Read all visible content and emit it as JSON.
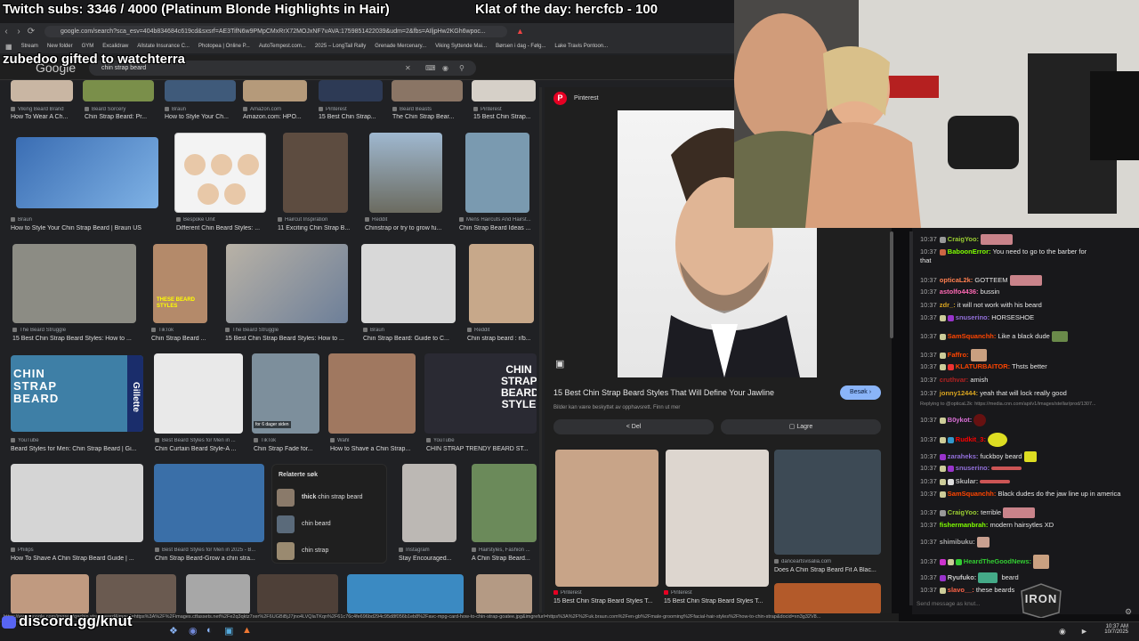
{
  "overlay": {
    "subs_goal": "Twitch subs: 3346 / 4000 (Platinum Blonde Highlights in Hair)",
    "klat": "Klat of the day: hercfcb - 100",
    "gift_alert": "zubedoo gifted to watchterra",
    "discord": "discord.gg/knut",
    "channel_logo": "IRON"
  },
  "browser": {
    "url": "google.com/search?sca_esv=404b834684c619cd&sxsrf=AE3TifN6w9PMpCMxRrX72MOJxNF7vAVA:1759851422039&udm=2&fbs=AIljpHw2KGh6wpoc...",
    "bookmarks": [
      "Stream",
      "New folder",
      "GYM",
      "Excalidraw",
      "Allstate Insurance C...",
      "Photopea | Online P...",
      "AutoTempest.com...",
      "2025 – LongTail Rally",
      "Grenade Mercenary...",
      "Viking Syttende Mai...",
      "Børsen i dag - Følg...",
      "Lake Travis Pontoon..."
    ],
    "search_query": "chin strap beard",
    "google_logo": "Google",
    "status_url": "https://www.google.com/imgres?q=chin strap beard&imgurl=https%3A%2F%2Fimages.ctfassets.net%2Fe2q3qktz7xer%2F6UGBiBjJ7jno4LVQlaTKqn%2F61c76c4fe696bd294c95d8f056b1eb8%2Favc-mpg-card-how-to-chin-strap-goatee.jpg&imgrefurl=https%3A%2F%2Fuk.braun.com%2Fen-gb%2Fmale-grooming%2Ffacial-hair-styles%2Fhow-to-chin-strap&docid=xn3g32V8..."
  },
  "results": [
    {
      "src": "Viking Beard Brand",
      "cap": "How To Wear A Ch..."
    },
    {
      "src": "Beard Sorcery",
      "cap": "Chin Strap Beard: Pr..."
    },
    {
      "src": "Braun",
      "cap": "How to Style Your Ch..."
    },
    {
      "src": "Amazon.com",
      "cap": "Amazon.com: HPO..."
    },
    {
      "src": "Pinterest",
      "cap": "15 Best Chin Strap..."
    },
    {
      "src": "Beard Beasts",
      "cap": "The Chin Strap Bear..."
    },
    {
      "src": "Pinterest",
      "cap": "15 Best Chin Strap..."
    },
    {
      "src": "Braun",
      "cap": "How to Style Your Chin Strap Beard | Braun US"
    },
    {
      "src": "Bespoke Unit",
      "cap": "Different Chin Beard Styles: ..."
    },
    {
      "src": "Haircut Inspiration",
      "cap": "11 Exciting Chin Strap B..."
    },
    {
      "src": "Reddit",
      "cap": "Chinstrap or try to grow fu..."
    },
    {
      "src": "Mens Haircuts And Hairst...",
      "cap": "Chin Strap Beard Ideas ..."
    },
    {
      "src": "The Beard Struggle",
      "cap": "15 Best Chin Strap Beard Styles: How to ..."
    },
    {
      "src": "TikTok",
      "cap": "Chin Strap Beard ..."
    },
    {
      "src": "The Beard Struggle",
      "cap": "15 Best Chin Strap Beard Styles: How to ..."
    },
    {
      "src": "Braun",
      "cap": "Chin Strap Beard: Guide to C..."
    },
    {
      "src": "Reddit",
      "cap": "Chin strap beard : r/b..."
    },
    {
      "src": "YouTube",
      "cap": "Beard Styles for Men: Chin Strap Beard | Gi..."
    },
    {
      "src": "Best Beard Styles for Men in ...",
      "cap": "Chin Curtain Beard Style-A ..."
    },
    {
      "src": "TikTok",
      "cap": "Chin Strap Fade for..."
    },
    {
      "src": "Wahl",
      "cap": "How to Shave a Chin Strap..."
    },
    {
      "src": "YouTube",
      "cap": "CHIN STRAP TRENDY BEARD ST..."
    },
    {
      "src": "Philips",
      "cap": "How To Shave A Chin Strap Beard Guide | ..."
    },
    {
      "src": "Best Beard Styles for Men in 2025 - B...",
      "cap": "Chin Strap Beard-Grow a chin stra..."
    },
    {
      "src": "Instagram",
      "cap": "Stay Encouraged..."
    },
    {
      "src": "Hairstyles, Fashion ...",
      "cap": "A Chin Strap Beard..."
    }
  ],
  "thumb_texts": {
    "chin_strap_beard": "CHIN STRAP BEARD",
    "gillette": "Gillette",
    "chin_strap_beard_style": "CHIN STRAP BEARD STYLE",
    "tiktok_badge": "for 6 dager siden",
    "these_beard": "THESE BEARD STYLES"
  },
  "related": {
    "title": "Relaterte søk",
    "items": [
      {
        "bold": "thick",
        "rest": " chin strap beard"
      },
      {
        "bold": "",
        "rest": "chin beard"
      },
      {
        "bold": "",
        "rest": "chin strap"
      }
    ]
  },
  "preview": {
    "source": "Pinterest",
    "title": "15 Best Chin Strap Beard Styles That Will Define Your Jawline",
    "visit": "Besøk",
    "notice": "Bilder kan være beskyttet av opphavsrett. Finn ut mer",
    "share": "Del",
    "save": "Lagre",
    "more": [
      {
        "src": "Pinterest",
        "cap": "15 Best Chin Strap Beard Styles T..."
      },
      {
        "src": "Pinterest",
        "cap": "15 Best Chin Strap Beard Styles T..."
      },
      {
        "src": "danceartsvisalia.com",
        "cap": "Does A Chin Strap Beard Fit A Blac..."
      }
    ]
  },
  "chat": {
    "placeholder": "Send message as knut...",
    "messages": [
      {
        "ts": "10:37",
        "user": "CraigYoo:",
        "text": "",
        "color": "#9acd32"
      },
      {
        "ts": "10:37",
        "user": "BaboonError:",
        "text": "You need to go to the barber for",
        "color": "#7fff00"
      },
      {
        "ts": "",
        "user": "",
        "text": "that",
        "color": "#fff"
      },
      {
        "ts": "10:37",
        "user": "opticaL2k:",
        "text": "GOTTEEM",
        "color": "#ff7f50"
      },
      {
        "ts": "10:37",
        "user": "astolfo4436:",
        "text": "bussin",
        "color": "#ff69b4"
      },
      {
        "ts": "10:37",
        "user": "zdr_:",
        "text": "it will not work with his beard",
        "color": "#daa520"
      },
      {
        "ts": "10:37",
        "user": "snuserino:",
        "text": "HORSESHOE",
        "color": "#9370db"
      },
      {
        "ts": "10:37",
        "user": "SamSquanchh:",
        "text": "Like a black dude",
        "color": "#ff4500"
      },
      {
        "ts": "10:37",
        "user": "Faffro:",
        "text": "",
        "color": "#ff4500"
      },
      {
        "ts": "10:37",
        "user": "KLATURBAITOR:",
        "text": "Thsts better",
        "color": "#ff4500"
      },
      {
        "ts": "10:37",
        "user": "cruthvar:",
        "text": "amish",
        "color": "#b22222"
      },
      {
        "ts": "10:37",
        "user": "jonny12444:",
        "text": "yeah that will lock really good",
        "color": "#daa520"
      },
      {
        "ts": "",
        "user": "Replying to @opticaL2k:",
        "text": "https://media.cnn.com/api/v1/images/stellar/prod/1307...",
        "color": "#888"
      },
      {
        "ts": "10:37",
        "user": "B0ykot:",
        "text": "",
        "color": "#da70d6"
      },
      {
        "ts": "10:37",
        "user": "Rudkit_3:",
        "text": "",
        "color": "#ff0000"
      },
      {
        "ts": "10:37",
        "user": "zaraheks:",
        "text": "fuckboy beard",
        "color": "#9370db"
      },
      {
        "ts": "10:37",
        "user": "snuserino:",
        "text": "",
        "color": "#9370db"
      },
      {
        "ts": "10:37",
        "user": "Skular:",
        "text": "",
        "color": "#bbb"
      },
      {
        "ts": "10:37",
        "user": "SamSquanchh:",
        "text": "Black dudes do the jaw line up in america",
        "color": "#ff4500"
      },
      {
        "ts": "10:37",
        "user": "CraigYoo:",
        "text": "terrible",
        "color": "#9acd32"
      },
      {
        "ts": "10:37",
        "user": "fishermanbrah:",
        "text": "modern hairsytles XD",
        "color": "#7fff00"
      },
      {
        "ts": "10:37",
        "user": "shimibuku:",
        "text": "",
        "color": "#aaa"
      },
      {
        "ts": "10:37",
        "user": "HeardTheGoodNews:",
        "text": "",
        "color": "#32cd32"
      },
      {
        "ts": "10:37",
        "user": "Ryufuko:",
        "text": "beard",
        "color": "#ccc"
      },
      {
        "ts": "10:37",
        "user": "slavo__:",
        "text": "these beards",
        "color": "#ff6347"
      }
    ]
  },
  "taskbar": {
    "time": "10:37 AM",
    "date": "10/7/2025"
  }
}
